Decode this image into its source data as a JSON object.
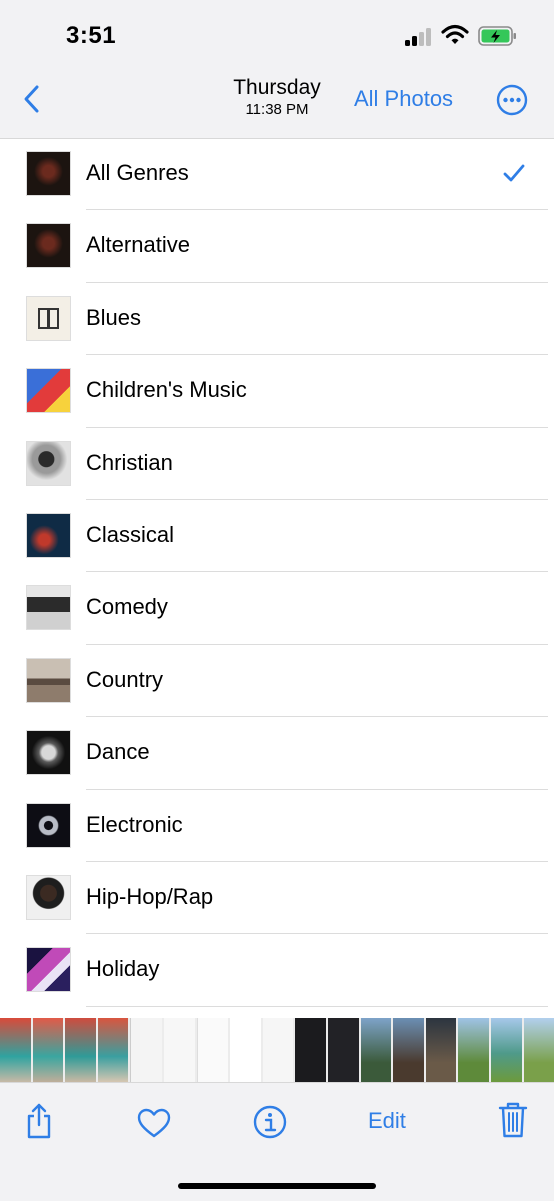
{
  "status": {
    "time": "3:51"
  },
  "nav": {
    "day": "Thursday",
    "clock": "11:38 PM",
    "all_photos": "All Photos"
  },
  "genres": [
    {
      "label": "All Genres",
      "selected": true
    },
    {
      "label": "Alternative"
    },
    {
      "label": "Blues"
    },
    {
      "label": "Children's Music"
    },
    {
      "label": "Christian"
    },
    {
      "label": "Classical"
    },
    {
      "label": "Comedy"
    },
    {
      "label": "Country"
    },
    {
      "label": "Dance"
    },
    {
      "label": "Electronic"
    },
    {
      "label": "Hip-Hop/Rap"
    },
    {
      "label": "Holiday"
    }
  ],
  "toolbar": {
    "edit": "Edit"
  },
  "colors": {
    "accent": "#2f7ee6",
    "bar_bg": "#f2f2f4"
  }
}
